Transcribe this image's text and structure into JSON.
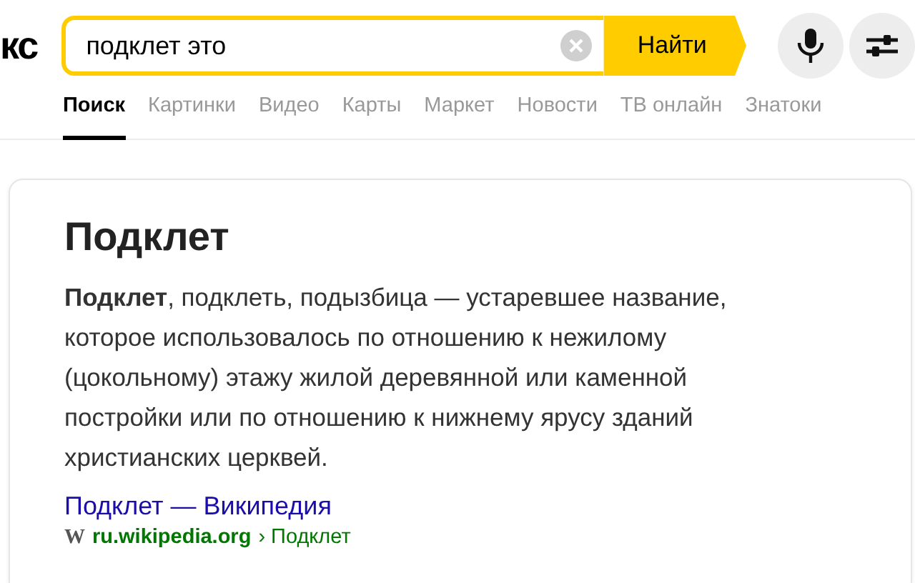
{
  "logo": "кс",
  "search": {
    "value": "подклет это",
    "button": "Найти"
  },
  "tabs": [
    {
      "label": "Поиск",
      "selected": true
    },
    {
      "label": "Картинки",
      "selected": false
    },
    {
      "label": "Видео",
      "selected": false
    },
    {
      "label": "Карты",
      "selected": false
    },
    {
      "label": "Маркет",
      "selected": false
    },
    {
      "label": "Новости",
      "selected": false
    },
    {
      "label": "ТВ онлайн",
      "selected": false
    },
    {
      "label": "Знатоки",
      "selected": false
    }
  ],
  "card": {
    "title": "Подклет",
    "text": "**Подклет**, подклеть, подызбица — устаревшее название, которое использовалось по отношению к нежилому (цокольному) этажу жилой деревянной или каменной постройки или по отношению к нижнему ярусу зданий христианских церквей.",
    "link": "Подклет — Википедия",
    "site_icon": "W",
    "domain": "ru.wikipedia.org",
    "path": "› Подклет"
  }
}
